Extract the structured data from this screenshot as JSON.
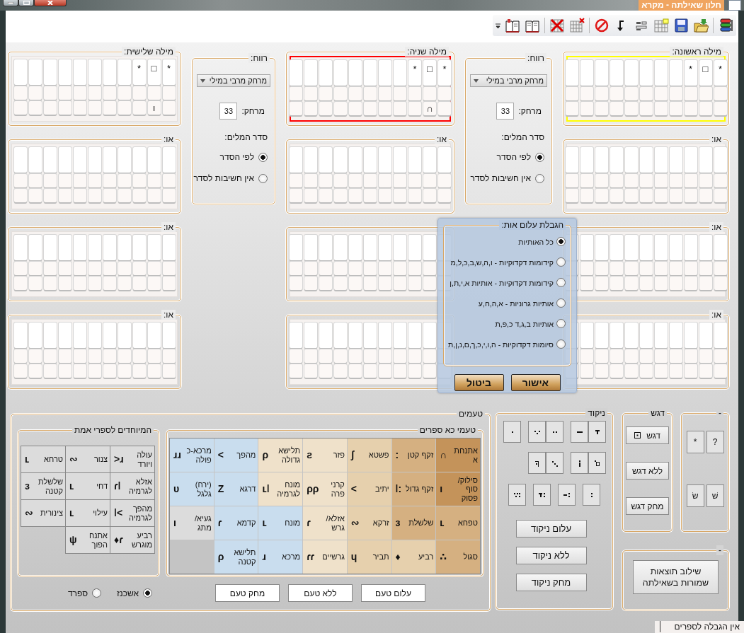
{
  "window": {
    "title": "חלון שאילתה - מקרא"
  },
  "words": [
    {
      "title": "מילה ראשונה:",
      "color": "#ffff00",
      "columns": [
        {
          "letter": "*"
        },
        {
          "letter": "□"
        },
        {
          "letter": "*"
        }
      ],
      "alternatives": [
        {
          "kind": "labelled",
          "label": "או:"
        },
        {
          "kind": "labelled",
          "label": "או:"
        },
        {
          "kind": "labelled",
          "label": "או:"
        }
      ]
    },
    {
      "title": "מילה שניה:",
      "color": "#ff0000",
      "columns": [
        {
          "letter": "*"
        },
        {
          "letter": "□",
          "accent": "∩"
        },
        {
          "letter": "*"
        }
      ],
      "alternatives": [
        {
          "kind": "labelled",
          "label": "או:"
        },
        {
          "kind": "covered"
        },
        {
          "kind": "covered"
        }
      ]
    },
    {
      "title": "מילה שלישית:",
      "columns": [
        {
          "letter": "*"
        },
        {
          "letter": "□",
          "accent": "ı"
        },
        {
          "letter": "*"
        }
      ],
      "alternatives": [
        {
          "kind": "labelled",
          "label": "או:"
        },
        {
          "kind": "labelled",
          "label": "או:"
        },
        {
          "kind": "labelled",
          "label": "או:"
        }
      ]
    }
  ],
  "spacings": [
    {
      "title": "רווח:",
      "mode": "מרחק מרבי במילי",
      "distance_label": "מרחק:",
      "distance": "33",
      "order_label": "סדר המלים:",
      "order_options": [
        {
          "label": "לפי הסדר",
          "selected": true
        },
        {
          "label": "אין חשיבות לסדר",
          "selected": false
        }
      ]
    },
    {
      "title": "רווח:",
      "mode": "מרחק מרבי במילי",
      "distance_label": "מרחק:",
      "distance": "33",
      "order_label": "סדר המלים:",
      "order_options": [
        {
          "label": "לפי הסדר",
          "selected": true
        },
        {
          "label": "אין חשיבות לסדר",
          "selected": false
        }
      ]
    }
  ],
  "letter_dialog": {
    "title": "הגבלת עלום אות:",
    "options": [
      {
        "label": "כל האותיות",
        "selected": true
      },
      {
        "label": "קידומות דקדוקיות - ו,ה,ש,ב,כ,ל,מ",
        "selected": false
      },
      {
        "label": "קידומות דקדוקיות - אותיות א,י,ת,ן",
        "selected": false
      },
      {
        "label": "אותיות גרוניות - א,ה,ח,ע",
        "selected": false
      },
      {
        "label": "אותיות ב,ג,ד  כ,פ,ת",
        "selected": false
      },
      {
        "label": "סיומות דקדוקיות - ה,ו,י,כ,ך,ם,נ,ן,ת",
        "selected": false
      }
    ],
    "buttons": [
      "אישור",
      "ביטול"
    ]
  },
  "taamim": {
    "title": "טעמים",
    "common": {
      "title": "טעמי כא ספרים",
      "cells": [
        {
          "name": "אתנחתא",
          "symbol": "∩",
          "color": "#c4935a"
        },
        {
          "name": "זקף קטן",
          "symbol": ":",
          "color": "#d5b081"
        },
        {
          "name": "פשטא",
          "symbol": "ʃ",
          "color": "#e6d0ad"
        },
        {
          "name": "פזר",
          "symbol": "ƨ",
          "color": "#efe1ca"
        },
        {
          "name": "תלישא גדולה",
          "symbol": "ρ",
          "color": "#efe1ca"
        },
        {
          "name": "מהפך",
          "symbol": "<",
          "color": "#c9ddee"
        },
        {
          "name": "מרכא-כפולה",
          "symbol": "ɹɹ",
          "color": "#c9ddee"
        },
        {
          "name": "סילוק/ סוף פסוק",
          "symbol": "ı",
          "color": "#c4935a"
        },
        {
          "name": "זקף גדול",
          "symbol": "ǀ:",
          "color": "#d5b081"
        },
        {
          "name": "יתיב",
          "symbol": "<",
          "color": "#e6d0ad"
        },
        {
          "name": "קרני פרה",
          "symbol": "ρρ",
          "color": "#efe1ca"
        },
        {
          "name": "מונח לגרמיה",
          "symbol": "ʟǀ",
          "color": "#efe1ca"
        },
        {
          "name": "דרגא",
          "symbol": "Z",
          "color": "#c9ddee"
        },
        {
          "name": "(ירח) גלגל",
          "symbol": "υ",
          "color": "#c9ddee"
        },
        {
          "name": "טפחא",
          "symbol": "ʟ",
          "color": "#d5b081"
        },
        {
          "name": "שלשלת",
          "symbol": "ɜ",
          "color": "#d5b081"
        },
        {
          "name": "זרקא",
          "symbol": "∾",
          "color": "#e6d0ad"
        },
        {
          "name": "אזלא/ גרש",
          "symbol": "ɾ",
          "color": "#efe1ca"
        },
        {
          "name": "מונח",
          "symbol": "ʟ",
          "color": "#c9ddee"
        },
        {
          "name": "קדמא",
          "symbol": "ɾ",
          "color": "#c9ddee"
        },
        {
          "name": "געיא/ מתג",
          "symbol": "ı",
          "color": "#dcdcdc"
        },
        {
          "name": "סגול",
          "symbol": "∴",
          "color": "#d5b081"
        },
        {
          "name": "רביע",
          "symbol": "♦",
          "color": "#e6d0ad"
        },
        {
          "name": "תביר",
          "symbol": "ɥ",
          "color": "#e6d0ad"
        },
        {
          "name": "גרשיים",
          "symbol": "ɾɾ",
          "color": "#efe1ca"
        },
        {
          "name": "מרכא",
          "symbol": "ɹ",
          "color": "#c9ddee"
        },
        {
          "name": "תלישא קטנה",
          "symbol": "ρ",
          "color": "#c9ddee"
        }
      ]
    },
    "special": {
      "title": "המיוחדים לספרי אמת",
      "cells": [
        {
          "name": "עולה ויורד",
          "symbol": ">ɹ"
        },
        {
          "name": "צנור",
          "symbol": "∾"
        },
        {
          "name": "טרחא",
          "symbol": "ʟ"
        },
        {
          "name": "אזלא לגרמיה",
          "symbol": "ɾǀ"
        },
        {
          "name": "דחי",
          "symbol": "ʟ"
        },
        {
          "name": "שלשלת קטנה",
          "symbol": "ɜ"
        },
        {
          "name": "מהפך לגרמיה",
          "symbol": "ǀ<"
        },
        {
          "name": "עילוי",
          "symbol": "ʟ"
        },
        {
          "name": "צינורית",
          "symbol": "∾"
        },
        {
          "name": "רביע מוגרש",
          "symbol": "♦ɾ"
        },
        {
          "name": "אתנח הפוך",
          "symbol": "ψ"
        }
      ]
    },
    "rite_options": [
      {
        "label": "אשכנז",
        "selected": true
      },
      {
        "label": "ספרד",
        "selected": false
      }
    ],
    "buttons": [
      "עלום טעם",
      "ללא טעם",
      "מחק טעם"
    ]
  },
  "niqqud": {
    "title": "ניקוד",
    "buttons": [
      "עלום ניקוד",
      "ללא ניקוד",
      "מחק ניקוד"
    ]
  },
  "dagesh": {
    "title": "דגש",
    "buttons": [
      {
        "label": "דגש",
        "kind": "marked"
      },
      {
        "label": "ללא דגש",
        "kind": "plain"
      },
      {
        "label": "מחק דגש",
        "kind": "plain"
      }
    ]
  },
  "symbols": {
    "title": "-",
    "buttons": [
      "?",
      "*",
      "שׁ",
      "שׂ"
    ]
  },
  "merge": {
    "title": "-",
    "button": "שילוב תוצאות שמורות בשאילתה"
  },
  "status_bar": {
    "books": "אין הגבלה לספרים"
  }
}
